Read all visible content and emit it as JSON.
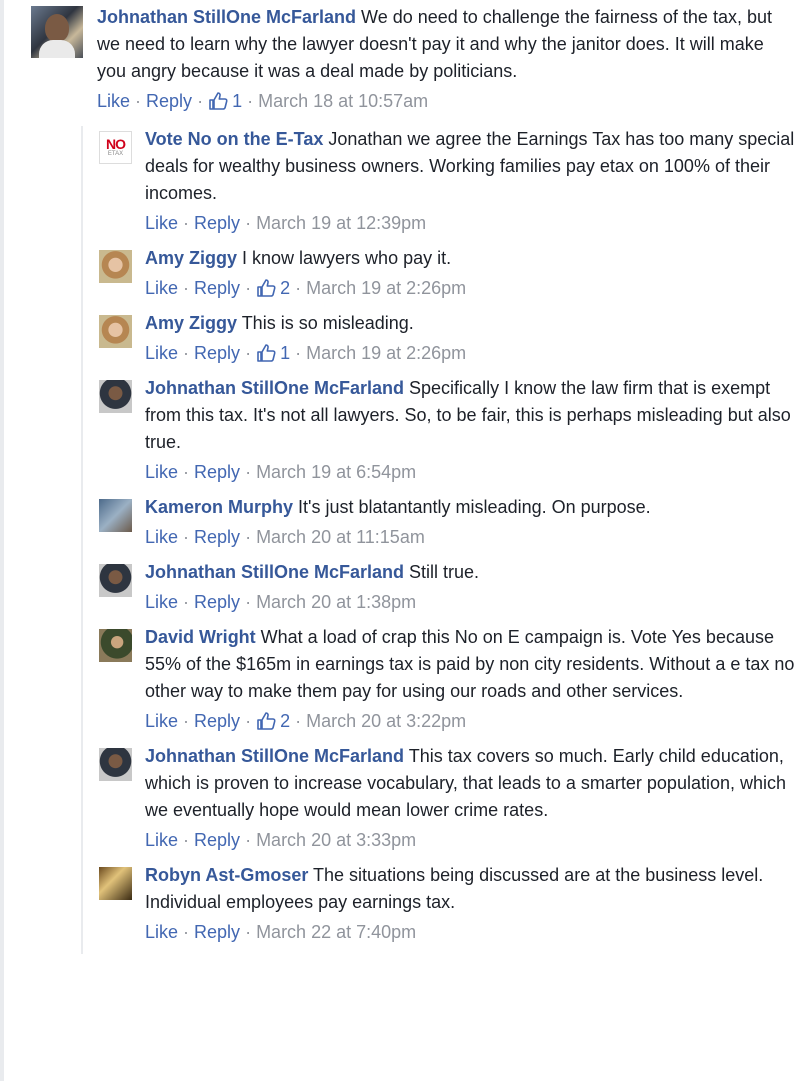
{
  "top_comment": {
    "author": "Johnathan StillOne McFarland",
    "text": " We do need to challenge the fairness of the tax, but we need to learn why the lawyer doesn't pay it and why the janitor does. It will make you angry because it was a deal made by politicians.",
    "like_label": "Like",
    "reply_label": "Reply",
    "likes": "1",
    "timestamp": "March 18 at 10:57am"
  },
  "replies": [
    {
      "author": "Vote No on the E-Tax",
      "text": " Jonathan we agree the Earnings Tax has too many special deals for wealthy business owners. Working families pay etax on 100% of their incomes.",
      "like_label": "Like",
      "reply_label": "Reply",
      "likes": "",
      "timestamp": "March 19 at 12:39pm",
      "avatar_text": {
        "no": "NO",
        "etax": "ETAX"
      }
    },
    {
      "author": "Amy Ziggy",
      "text": " I know lawyers who pay it.",
      "like_label": "Like",
      "reply_label": "Reply",
      "likes": "2",
      "timestamp": "March 19 at 2:26pm"
    },
    {
      "author": "Amy Ziggy",
      "text": " This is so misleading.",
      "like_label": "Like",
      "reply_label": "Reply",
      "likes": "1",
      "timestamp": "March 19 at 2:26pm"
    },
    {
      "author": "Johnathan StillOne McFarland",
      "text": " Specifically I know the law firm that is exempt from this tax. It's not all lawyers. So, to be fair, this is perhaps misleading but also true.",
      "like_label": "Like",
      "reply_label": "Reply",
      "likes": "",
      "timestamp": "March 19 at 6:54pm"
    },
    {
      "author": "Kameron Murphy",
      "text": " It's just blatantantly misleading. On purpose.",
      "like_label": "Like",
      "reply_label": "Reply",
      "likes": "",
      "timestamp": "March 20 at 11:15am"
    },
    {
      "author": "Johnathan StillOne McFarland",
      "text": " Still true.",
      "like_label": "Like",
      "reply_label": "Reply",
      "likes": "",
      "timestamp": "March 20 at 1:38pm"
    },
    {
      "author": "David Wright",
      "text": " What a load of crap this No on E campaign is. Vote Yes because 55% of the $165m in earnings tax is paid by non city residents. Without a e tax no other way to make them pay for using our roads and other services.",
      "like_label": "Like",
      "reply_label": "Reply",
      "likes": "2",
      "timestamp": "March 20 at 3:22pm"
    },
    {
      "author": "Johnathan StillOne McFarland",
      "text": " This tax covers so much. Early child education, which is proven to increase vocabulary, that leads to a smarter population, which we eventually hope would mean lower crime rates.",
      "like_label": "Like",
      "reply_label": "Reply",
      "likes": "",
      "timestamp": "March 20 at 3:33pm"
    },
    {
      "author": "Robyn Ast-Gmoser",
      "text": " The situations being discussed are at the business level. Individual employees pay earnings tax.",
      "like_label": "Like",
      "reply_label": "Reply",
      "likes": "",
      "timestamp": "March 22 at 7:40pm"
    }
  ],
  "colors": {
    "author": "#365899",
    "link": "#4267b2",
    "meta": "#90949c",
    "text": "#1d2129"
  }
}
